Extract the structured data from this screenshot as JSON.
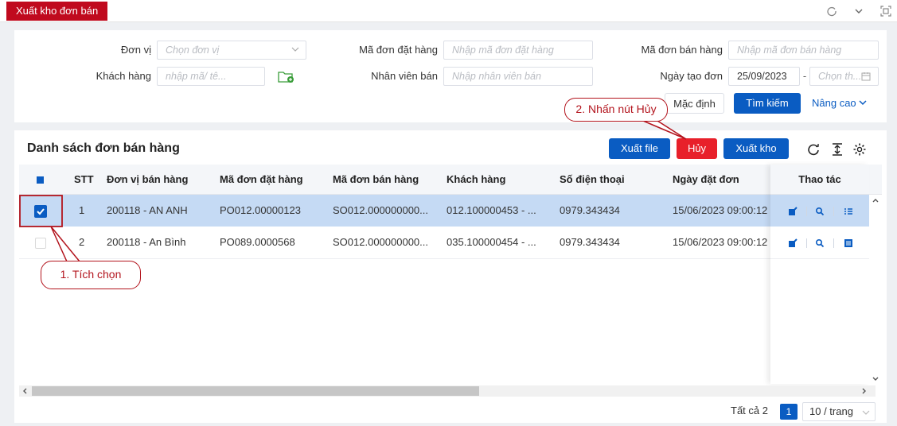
{
  "tab": {
    "title": "Xuất kho đơn bán"
  },
  "top_icons": {
    "refresh": "refresh-icon",
    "collapse": "chevron-down-icon",
    "fullscreen": "fullscreen-icon"
  },
  "filters": {
    "don_vi": {
      "label": "Đơn vị",
      "placeholder": "Chọn đơn vị"
    },
    "ma_don_dat_hang": {
      "label": "Mã đơn đặt hàng",
      "placeholder": "Nhập mã đơn đặt hàng"
    },
    "ma_don_ban_hang": {
      "label": "Mã đơn bán hàng",
      "placeholder": "Nhập mã đơn bán hàng"
    },
    "khach_hang": {
      "label": "Khách hàng",
      "placeholder": "nhập mã/ tê..."
    },
    "nhan_vien_ban": {
      "label": "Nhân viên bán",
      "placeholder": "Nhập nhân viên bán"
    },
    "ngay_tao_don": {
      "label": "Ngày tạo đơn",
      "from": "25/09/2023",
      "separator": "-",
      "to_placeholder": "Chọn th..."
    },
    "default_label": "Mặc định",
    "search_label": "Tìm kiếm",
    "advanced_label": "Nâng cao"
  },
  "list": {
    "title": "Danh sách đơn bán hàng",
    "export_file_label": "Xuất file",
    "cancel_label": "Hủy",
    "export_stock_label": "Xuất kho",
    "columns": [
      "STT",
      "Đơn vị bán hàng",
      "Mã đơn đặt hàng",
      "Mã đơn bán hàng",
      "Khách hàng",
      "Số điện thoại",
      "Ngày đặt đơn",
      "Thao tác"
    ],
    "rows": [
      {
        "stt": "1",
        "don_vi": "200118 - AN ANH",
        "ma_dat": "PO012.00000123",
        "ma_ban": "SO012.000000000...",
        "khach": "012.100000453 - ...",
        "sdt": "0979.343434",
        "ngay": "15/06/2023 09:00:12",
        "checked": true
      },
      {
        "stt": "2",
        "don_vi": "200118 - An Bình",
        "ma_dat": "PO089.0000568",
        "ma_ban": "SO012.000000000...",
        "khach": "035.100000454 - ...",
        "sdt": "0979.343434",
        "ngay": "15/06/2023 09:00:12",
        "checked": false
      }
    ]
  },
  "pagination": {
    "total_label": "Tất cả 2",
    "current_page": "1",
    "page_size": "10 / trang"
  },
  "annotations": {
    "step1": "1. Tích chọn",
    "step2": "2. Nhấn nút Hủy"
  },
  "colors": {
    "brand_red": "#c00a1e",
    "primary_blue": "#0a5cc2",
    "selected_row": "#c5daf4",
    "annotation_red": "#b3141d"
  }
}
